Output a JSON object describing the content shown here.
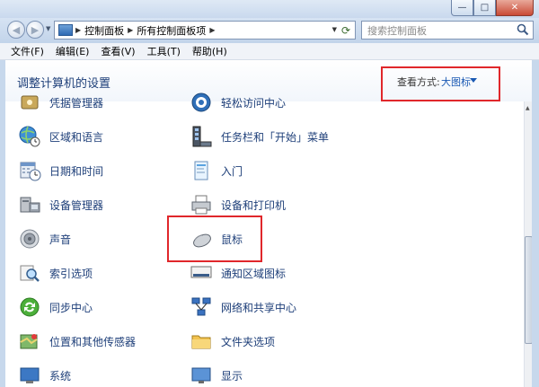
{
  "window": {
    "buttons": {
      "minimize": "—",
      "maximize": "□",
      "close": "✕"
    }
  },
  "address": {
    "segments": [
      "控制面板",
      "所有控制面板项"
    ],
    "search_placeholder": "搜索控制面板"
  },
  "menu": [
    "文件(F)",
    "编辑(E)",
    "查看(V)",
    "工具(T)",
    "帮助(H)"
  ],
  "header": {
    "title": "调整计算机的设置",
    "view_mode_label": "查看方式:",
    "view_mode_value": "大图标"
  },
  "items": {
    "left": [
      "凭据管理器",
      "区域和语言",
      "日期和时间",
      "设备管理器",
      "声音",
      "索引选项",
      "同步中心",
      "位置和其他传感器",
      "系统"
    ],
    "right": [
      "轻松访问中心",
      "任务栏和「开始」菜单",
      "入门",
      "设备和打印机",
      "鼠标",
      "通知区域图标",
      "网络和共享中心",
      "文件夹选项",
      "显示"
    ]
  },
  "icons": {
    "left": [
      "credential-icon",
      "globe-clock-icon",
      "calendar-clock-icon",
      "device-manager-icon",
      "speaker-icon",
      "index-search-icon",
      "sync-center-icon",
      "location-sensor-icon",
      "system-icon"
    ],
    "right": [
      "ease-of-access-icon",
      "taskbar-icon",
      "getting-started-icon",
      "printer-icon",
      "mouse-icon",
      "notification-area-icon",
      "network-icon",
      "folder-options-icon",
      "display-icon"
    ]
  },
  "colors": {
    "link": "#1e3f79",
    "accent": "#1a59b3",
    "highlight": "#e0272b"
  }
}
